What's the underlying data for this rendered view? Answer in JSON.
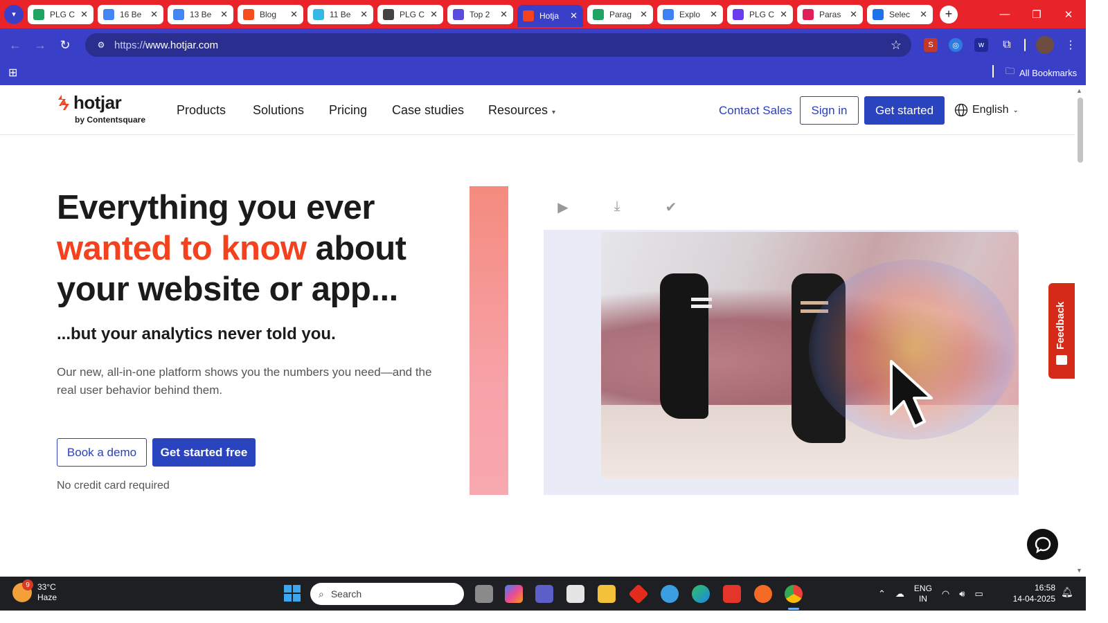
{
  "browser": {
    "tabs": [
      {
        "title": "PLG C",
        "favicon": "sheets-icon",
        "color": "#1fa463"
      },
      {
        "title": "16 Be",
        "favicon": "docs-icon",
        "color": "#4285f4"
      },
      {
        "title": "13 Be",
        "favicon": "docs-icon",
        "color": "#4285f4"
      },
      {
        "title": "Blog",
        "favicon": "figma-icon",
        "color": "#f24e1e"
      },
      {
        "title": "11 Be",
        "favicon": "bird-icon",
        "color": "#35b8e6"
      },
      {
        "title": "PLG C",
        "favicon": "openai-icon",
        "color": "#444444"
      },
      {
        "title": "Top 2",
        "favicon": "triangle-icon",
        "color": "#5b4ce0"
      },
      {
        "title": "Hotja",
        "favicon": "hotjar-icon",
        "color": "#f4411e",
        "active": true
      },
      {
        "title": "Parag",
        "favicon": "sheets-icon",
        "color": "#1fa463"
      },
      {
        "title": "Explo",
        "favicon": "copilot-icon",
        "color": "#3b82f6"
      },
      {
        "title": "PLG C",
        "favicon": "purple-icon",
        "color": "#6a3cf0"
      },
      {
        "title": "Paras",
        "favicon": "slack-icon",
        "color": "#e01e5a"
      },
      {
        "title": "Selec",
        "favicon": "globe-icon",
        "color": "#1a73e8"
      }
    ],
    "url_scheme": "https://",
    "url_host": "www.hotjar.com",
    "bookmarks_label": "All Bookmarks"
  },
  "site": {
    "logo_word": "hotjar",
    "logo_by": "by Contentsquare",
    "nav": [
      "Products",
      "Solutions",
      "Pricing",
      "Case studies",
      "Resources"
    ],
    "contact_sales": "Contact Sales",
    "sign_in": "Sign in",
    "get_started": "Get started",
    "language": "English"
  },
  "hero": {
    "title_line1": "Everything you ever",
    "title_highlight": "wanted to know",
    "title_after_highlight": " about",
    "title_line3": "your website or app...",
    "subtitle": "...but your analytics never told you.",
    "body": "Our new, all-in-one platform shows you the numbers you need—and the real user behavior behind them.",
    "book_demo": "Book a demo",
    "get_started_free": "Get started free",
    "no_card": "No credit card required"
  },
  "feedback_label": "Feedback",
  "taskbar": {
    "weather_temp": "33°C",
    "weather_desc": "Haze",
    "weather_badge": "9",
    "search_placeholder": "Search",
    "lang_line1": "ENG",
    "lang_line2": "IN",
    "time": "16:58",
    "date": "14-04-2025"
  },
  "colors": {
    "accent_blue": "#3a3fc8",
    "tab_bar_red": "#e8232a",
    "hotjar_orange": "#f4411e",
    "cta_blue": "#2a44c0"
  }
}
